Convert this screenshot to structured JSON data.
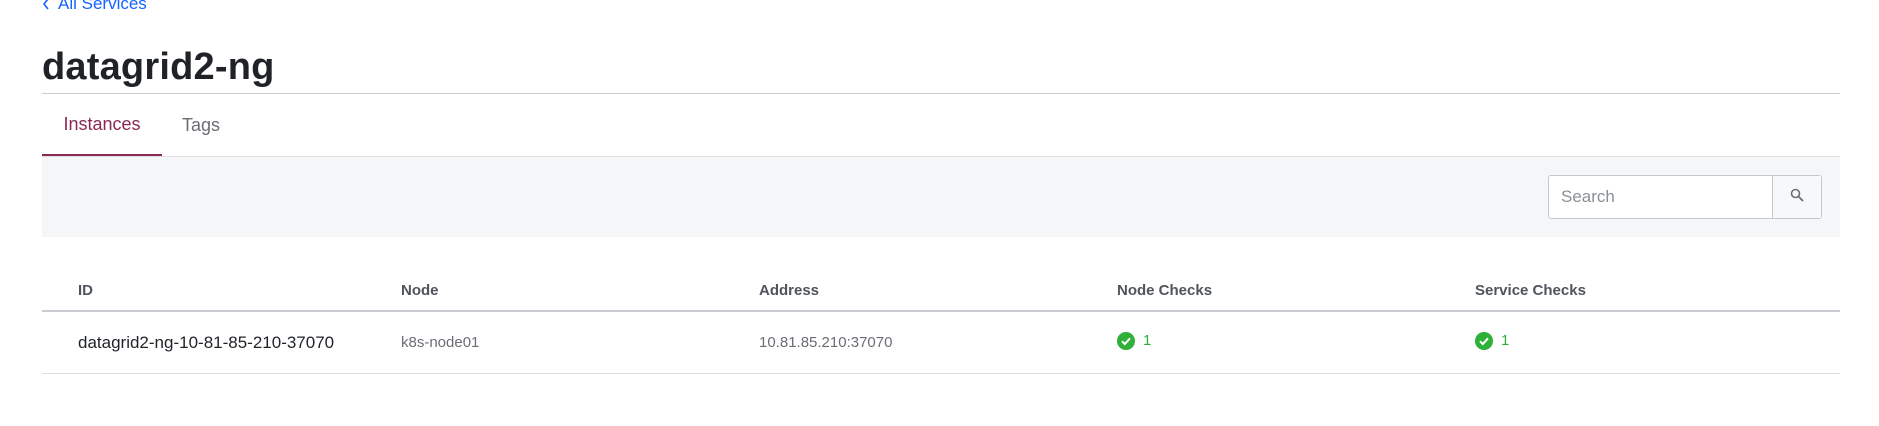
{
  "breadcrumb": {
    "label": "All Services"
  },
  "page": {
    "title": "datagrid2-ng"
  },
  "tabs": [
    {
      "label": "Instances",
      "active": true
    },
    {
      "label": "Tags",
      "active": false
    }
  ],
  "search": {
    "placeholder": "Search",
    "value": ""
  },
  "table": {
    "columns": [
      "ID",
      "Node",
      "Address",
      "Node Checks",
      "Service Checks"
    ],
    "rows": [
      {
        "id": "datagrid2-ng-10-81-85-210-37070",
        "node": "k8s-node01",
        "address": "10.81.85.210:37070",
        "node_checks": "1",
        "service_checks": "1"
      }
    ]
  },
  "colors": {
    "link": "#1563ff",
    "active_tab": "#8a2a52",
    "passing": "#2eb039"
  },
  "icons": {
    "breadcrumb": "chevron-left-icon",
    "search": "search-icon",
    "check": "check-circle-icon"
  }
}
